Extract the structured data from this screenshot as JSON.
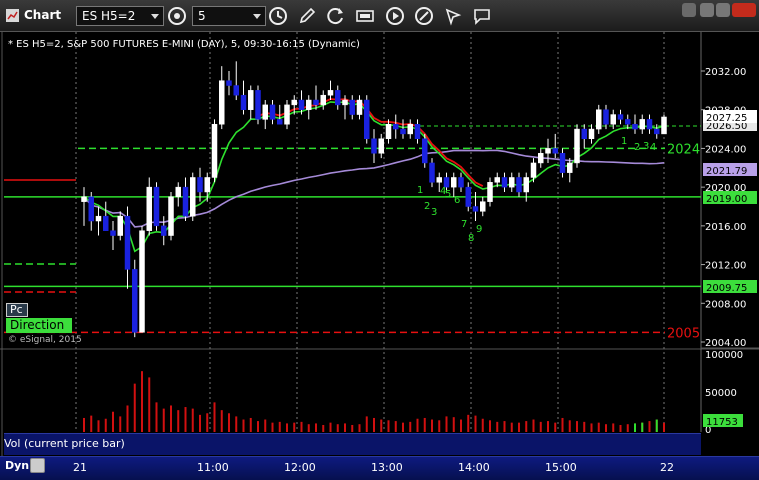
{
  "window": {
    "title": "Chart",
    "symbol": "ES H5=2",
    "interval": "5"
  },
  "toolbar_icons": [
    "properties-icon",
    "clock-icon",
    "pencil-icon",
    "refresh-icon",
    "ticker-icon",
    "play-icon",
    "tools-icon",
    "chat-icon"
  ],
  "chart_info": "* ES H5=2, S&P 500 FUTURES E-MINI (DAY), 5, 09:30-16:15 (Dynamic)",
  "indicators": {
    "pc": "Pc",
    "direction": "Direction",
    "copyright": "© eSignal, 2015"
  },
  "price_axis": {
    "ticks": [
      "2032.00",
      "2028.00",
      "2024.00",
      "2020.00",
      "2016.00",
      "2012.00",
      "2008.00",
      "2004.00"
    ],
    "labels": {
      "last": "2027.25",
      "behind": "2026.50",
      "ma_purple": "2021.79",
      "green_line": "2019.00",
      "low_line": "2009.75",
      "level_2024": "2024",
      "level_2005": "2005"
    }
  },
  "volume": {
    "label": "Vol (current price bar)",
    "ticks": [
      "100000",
      "50000",
      "0"
    ],
    "current": "11753"
  },
  "time_axis": {
    "mode": "Dyn",
    "labels": [
      "21",
      "11:00",
      "12:00",
      "13:00",
      "14:00",
      "15:00",
      "22"
    ]
  },
  "setup_counts": [
    "1",
    "2",
    "3",
    "4",
    "5",
    "6",
    "7",
    "8",
    "9",
    "1",
    "2",
    "3",
    "4"
  ],
  "colors": {
    "up_candle": "#ffffff",
    "down_candle": "#1a22e0",
    "ma_fast": "#2ee02e",
    "ma_red": "#e81010",
    "ma_purple": "#a58ad8",
    "level_green": "#2ee02e",
    "level_red": "#e81010",
    "volume_bars": "#d21010"
  },
  "chart_data": {
    "type": "candlestick",
    "x": [
      "09:30",
      "09:35",
      "09:40",
      "09:45",
      "09:50",
      "09:55",
      "10:00",
      "10:05",
      "10:10",
      "10:15",
      "10:20",
      "10:25",
      "10:30",
      "10:35",
      "10:40",
      "10:45",
      "10:50",
      "10:55",
      "11:00",
      "11:05",
      "11:10",
      "11:15",
      "11:20",
      "11:25",
      "11:30",
      "11:35",
      "11:40",
      "11:45",
      "11:50",
      "11:55",
      "12:00",
      "12:05",
      "12:10",
      "12:15",
      "12:20",
      "12:25",
      "12:30",
      "12:35",
      "12:40",
      "12:45",
      "12:50",
      "12:55",
      "13:00",
      "13:05",
      "13:10",
      "13:15",
      "13:20",
      "13:25",
      "13:30",
      "13:35",
      "13:40",
      "13:45",
      "13:50",
      "13:55",
      "14:00",
      "14:05",
      "14:10",
      "14:15",
      "14:20",
      "14:25",
      "14:30",
      "14:35",
      "14:40",
      "14:45",
      "14:50",
      "14:55",
      "15:00",
      "15:05",
      "15:10",
      "15:15",
      "15:20",
      "15:25",
      "15:30",
      "15:35",
      "15:40",
      "15:45",
      "15:50",
      "15:55",
      "16:00",
      "16:05",
      "16:10"
    ],
    "ohlc": [
      [
        2018.5,
        2020.0,
        2016.0,
        2019.0
      ],
      [
        2019.0,
        2019.5,
        2015.5,
        2016.5
      ],
      [
        2016.5,
        2018.0,
        2015.0,
        2017.0
      ],
      [
        2017.0,
        2018.5,
        2015.5,
        2015.5
      ],
      [
        2015.5,
        2016.5,
        2013.5,
        2015.0
      ],
      [
        2015.0,
        2017.5,
        2014.5,
        2017.0
      ],
      [
        2017.0,
        2018.0,
        2009.5,
        2011.5
      ],
      [
        2011.5,
        2012.5,
        2004.5,
        2005.0
      ],
      [
        2005.0,
        2016.0,
        2005.0,
        2015.5
      ],
      [
        2015.5,
        2021.0,
        2015.0,
        2020.0
      ],
      [
        2020.0,
        2020.5,
        2015.5,
        2016.0
      ],
      [
        2016.0,
        2017.0,
        2014.0,
        2015.0
      ],
      [
        2015.0,
        2019.5,
        2014.5,
        2019.0
      ],
      [
        2019.0,
        2020.5,
        2018.0,
        2020.0
      ],
      [
        2020.0,
        2021.0,
        2016.5,
        2017.0
      ],
      [
        2017.0,
        2021.5,
        2016.5,
        2021.0
      ],
      [
        2021.0,
        2022.0,
        2018.5,
        2019.5
      ],
      [
        2019.5,
        2021.5,
        2018.5,
        2021.0
      ],
      [
        2021.0,
        2027.0,
        2020.5,
        2026.5
      ],
      [
        2026.5,
        2032.5,
        2026.0,
        2031.0
      ],
      [
        2031.0,
        2032.0,
        2029.5,
        2030.5
      ],
      [
        2030.5,
        2033.0,
        2029.0,
        2029.5
      ],
      [
        2029.5,
        2031.0,
        2027.5,
        2028.0
      ],
      [
        2028.0,
        2030.5,
        2027.0,
        2030.0
      ],
      [
        2030.0,
        2030.5,
        2026.5,
        2027.0
      ],
      [
        2027.0,
        2029.0,
        2026.0,
        2028.5
      ],
      [
        2028.5,
        2029.0,
        2026.5,
        2027.0
      ],
      [
        2027.0,
        2028.5,
        2026.5,
        2026.5
      ],
      [
        2026.5,
        2029.0,
        2026.0,
        2028.5
      ],
      [
        2028.5,
        2029.5,
        2027.5,
        2029.0
      ],
      [
        2029.0,
        2030.0,
        2027.5,
        2028.0
      ],
      [
        2028.0,
        2029.5,
        2027.0,
        2029.0
      ],
      [
        2029.0,
        2030.5,
        2028.0,
        2028.5
      ],
      [
        2028.5,
        2030.0,
        2028.0,
        2029.5
      ],
      [
        2029.5,
        2031.0,
        2029.0,
        2030.0
      ],
      [
        2030.0,
        2030.5,
        2028.0,
        2028.5
      ],
      [
        2028.5,
        2029.5,
        2027.0,
        2029.0
      ],
      [
        2029.0,
        2029.5,
        2027.0,
        2027.5
      ],
      [
        2027.5,
        2029.5,
        2027.0,
        2029.0
      ],
      [
        2029.0,
        2029.5,
        2024.5,
        2025.0
      ],
      [
        2025.0,
        2026.0,
        2022.5,
        2023.5
      ],
      [
        2023.5,
        2025.5,
        2023.0,
        2025.0
      ],
      [
        2025.0,
        2027.0,
        2024.5,
        2026.5
      ],
      [
        2026.5,
        2027.5,
        2025.0,
        2026.0
      ],
      [
        2026.0,
        2027.0,
        2025.0,
        2025.5
      ],
      [
        2025.5,
        2027.0,
        2025.0,
        2026.5
      ],
      [
        2026.5,
        2027.0,
        2024.5,
        2025.0
      ],
      [
        2025.0,
        2025.5,
        2022.0,
        2022.5
      ],
      [
        2022.5,
        2023.0,
        2020.0,
        2020.5
      ],
      [
        2020.5,
        2021.5,
        2019.5,
        2021.0
      ],
      [
        2021.0,
        2021.5,
        2019.5,
        2020.0
      ],
      [
        2020.0,
        2021.5,
        2019.0,
        2021.0
      ],
      [
        2021.0,
        2021.5,
        2019.5,
        2020.0
      ],
      [
        2020.0,
        2020.5,
        2017.5,
        2018.0
      ],
      [
        2018.0,
        2019.5,
        2016.5,
        2017.5
      ],
      [
        2017.5,
        2019.0,
        2017.0,
        2018.5
      ],
      [
        2018.5,
        2021.0,
        2018.0,
        2020.5
      ],
      [
        2020.5,
        2021.5,
        2020.0,
        2021.0
      ],
      [
        2021.0,
        2021.5,
        2019.5,
        2020.0
      ],
      [
        2020.0,
        2021.5,
        2019.5,
        2021.0
      ],
      [
        2021.0,
        2021.5,
        2019.0,
        2019.5
      ],
      [
        2019.5,
        2021.5,
        2018.5,
        2021.0
      ],
      [
        2021.0,
        2023.0,
        2020.5,
        2022.5
      ],
      [
        2022.5,
        2024.0,
        2022.0,
        2023.5
      ],
      [
        2023.5,
        2025.0,
        2022.5,
        2024.0
      ],
      [
        2024.0,
        2025.5,
        2023.0,
        2023.5
      ],
      [
        2023.5,
        2024.0,
        2021.0,
        2021.5
      ],
      [
        2021.5,
        2023.0,
        2020.5,
        2022.5
      ],
      [
        2022.5,
        2026.5,
        2022.0,
        2026.0
      ],
      [
        2026.0,
        2026.5,
        2024.0,
        2025.0
      ],
      [
        2025.0,
        2026.5,
        2024.5,
        2026.0
      ],
      [
        2026.0,
        2028.5,
        2025.5,
        2028.0
      ],
      [
        2028.0,
        2028.5,
        2026.0,
        2026.5
      ],
      [
        2026.5,
        2028.0,
        2026.0,
        2027.5
      ],
      [
        2027.5,
        2028.0,
        2026.5,
        2027.0
      ],
      [
        2027.0,
        2027.5,
        2026.0,
        2026.5
      ],
      [
        2026.5,
        2027.5,
        2025.5,
        2026.0
      ],
      [
        2026.0,
        2027.5,
        2025.5,
        2027.0
      ],
      [
        2027.0,
        2027.5,
        2025.5,
        2026.0
      ],
      [
        2026.0,
        2026.5,
        2025.0,
        2025.5
      ],
      [
        2025.5,
        2027.5,
        2025.5,
        2027.25
      ]
    ],
    "volume": [
      18000,
      21000,
      15000,
      17000,
      26000,
      20000,
      34000,
      62000,
      78000,
      70000,
      38000,
      30000,
      34000,
      28000,
      32000,
      30000,
      22000,
      24000,
      38000,
      28000,
      24000,
      20000,
      16000,
      18000,
      14000,
      16000,
      12000,
      13000,
      11000,
      12000,
      13000,
      10000,
      11000,
      9000,
      12000,
      10000,
      11000,
      9000,
      10000,
      20000,
      18000,
      16000,
      15000,
      14000,
      12000,
      13000,
      17000,
      18000,
      16000,
      15000,
      20000,
      19000,
      16000,
      22000,
      21000,
      17000,
      15000,
      13000,
      14000,
      12000,
      12000,
      14000,
      16000,
      13000,
      14000,
      12000,
      18000,
      15000,
      14000,
      13000,
      11000,
      12000,
      10000,
      11000,
      9000,
      10000,
      11000,
      12000,
      14000,
      16000,
      11753
    ],
    "horizontal_levels": [
      2024,
      2019,
      2009.75,
      2005
    ],
    "ylim": [
      2003,
      2035
    ],
    "volume_ylim": [
      0,
      100000
    ]
  }
}
